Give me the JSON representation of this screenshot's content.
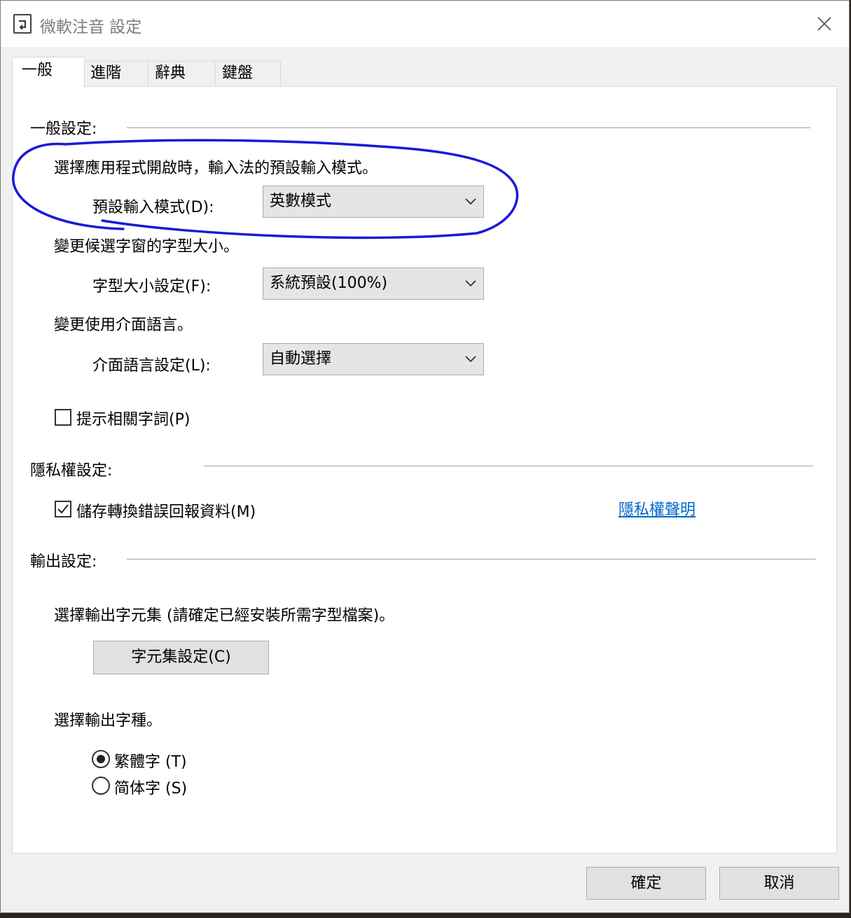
{
  "window": {
    "title": "微軟注音 設定"
  },
  "tabs": [
    {
      "label": "一般"
    },
    {
      "label": "進階"
    },
    {
      "label": "辭典"
    },
    {
      "label": "鍵盤"
    }
  ],
  "general": {
    "section_label": "一般設定:",
    "input_mode_desc": "選擇應用程式開啟時，輸入法的預設輸入模式。",
    "input_mode_label": "預設輸入模式(D):",
    "input_mode_value": "英數模式",
    "font_size_desc": "變更候選字窗的字型大小。",
    "font_size_label": "字型大小設定(F):",
    "font_size_value": "系統預設(100%)",
    "ui_lang_desc": "變更使用介面語言。",
    "ui_lang_label": "介面語言設定(L):",
    "ui_lang_value": "自動選擇",
    "suggest_label": "提示相關字詞(P)",
    "suggest_checked": false
  },
  "privacy": {
    "section_label": "隱私權設定:",
    "save_report_label": "儲存轉換錯誤回報資料(M)",
    "save_report_checked": true,
    "statement_link": "隱私權聲明"
  },
  "output": {
    "section_label": "輸出設定:",
    "charset_desc": "選擇輸出字元集 (請確定已經安裝所需字型檔案)。",
    "charset_button": "字元集設定(C)",
    "script_desc": "選擇輸出字種。",
    "traditional_label": "繁體字 (T)",
    "simplified_label": "简体字 (S)",
    "selected": "traditional"
  },
  "footer": {
    "ok_label": "確定",
    "cancel_label": "取消"
  },
  "colors": {
    "annotation_ink": "#1a1ad6",
    "link": "#0066cc"
  }
}
